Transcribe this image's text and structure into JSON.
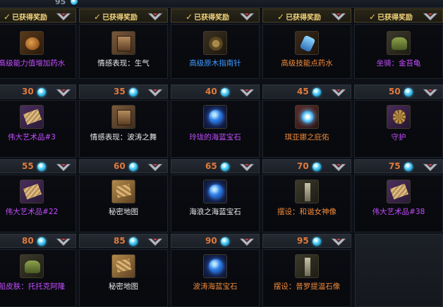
{
  "top": {
    "points": "95"
  },
  "claimed_label": "已获得奖励",
  "rows": [
    {
      "claimed": true,
      "cells": [
        {
          "item": "高级能力值增加药水",
          "color": "purple",
          "icon": "pot-icon"
        },
        {
          "item": "情感表现：生气",
          "color": "white",
          "icon": "book-icon"
        },
        {
          "item": "高级原木指南针",
          "color": "blue",
          "icon": "compass-icon"
        },
        {
          "item": "高级技能点药水",
          "color": "orange",
          "icon": "bottle-icon"
        },
        {
          "item": "坐骑：金苔龟",
          "color": "purple",
          "icon": "mount-icon"
        }
      ]
    },
    {
      "claimed": false,
      "cells": [
        {
          "points": "30",
          "item": "伟大艺术品#3",
          "color": "purple",
          "icon": "art-icon"
        },
        {
          "points": "35",
          "item": "情感表现：波涛之舞",
          "color": "white",
          "icon": "book-icon"
        },
        {
          "points": "40",
          "item": "玲珑的海蓝宝石",
          "color": "purple",
          "icon": "gem-icon"
        },
        {
          "points": "45",
          "item": "琪亚娜之庇佑",
          "color": "orange",
          "icon": "orb-icon"
        },
        {
          "points": "50",
          "item": "守护",
          "color": "purple",
          "icon": "shield-icon"
        }
      ]
    },
    {
      "claimed": false,
      "cells": [
        {
          "points": "55",
          "item": "伟大艺术品#22",
          "color": "purple",
          "icon": "art-icon"
        },
        {
          "points": "60",
          "item": "秘密地图",
          "color": "white",
          "icon": "map-icon"
        },
        {
          "points": "65",
          "item": "海浪之海蓝宝石",
          "color": "white",
          "icon": "gem-icon"
        },
        {
          "points": "70",
          "item": "摆设：和谐女神像",
          "color": "orange",
          "icon": "statue-icon"
        },
        {
          "points": "75",
          "item": "伟大艺术品#38",
          "color": "purple",
          "icon": "art-icon"
        }
      ]
    },
    {
      "claimed": false,
      "cells": [
        {
          "points": "80",
          "item": "船皮肤：托托克阿隆",
          "color": "purple",
          "icon": "ship-icon"
        },
        {
          "points": "85",
          "item": "秘密地图",
          "color": "white",
          "icon": "map-icon"
        },
        {
          "points": "90",
          "item": "波涛海蓝宝石",
          "color": "orange",
          "icon": "gem-icon"
        },
        {
          "points": "95",
          "item": "摆设：普罗提温石像",
          "color": "orange",
          "icon": "statue-icon"
        }
      ]
    }
  ]
}
